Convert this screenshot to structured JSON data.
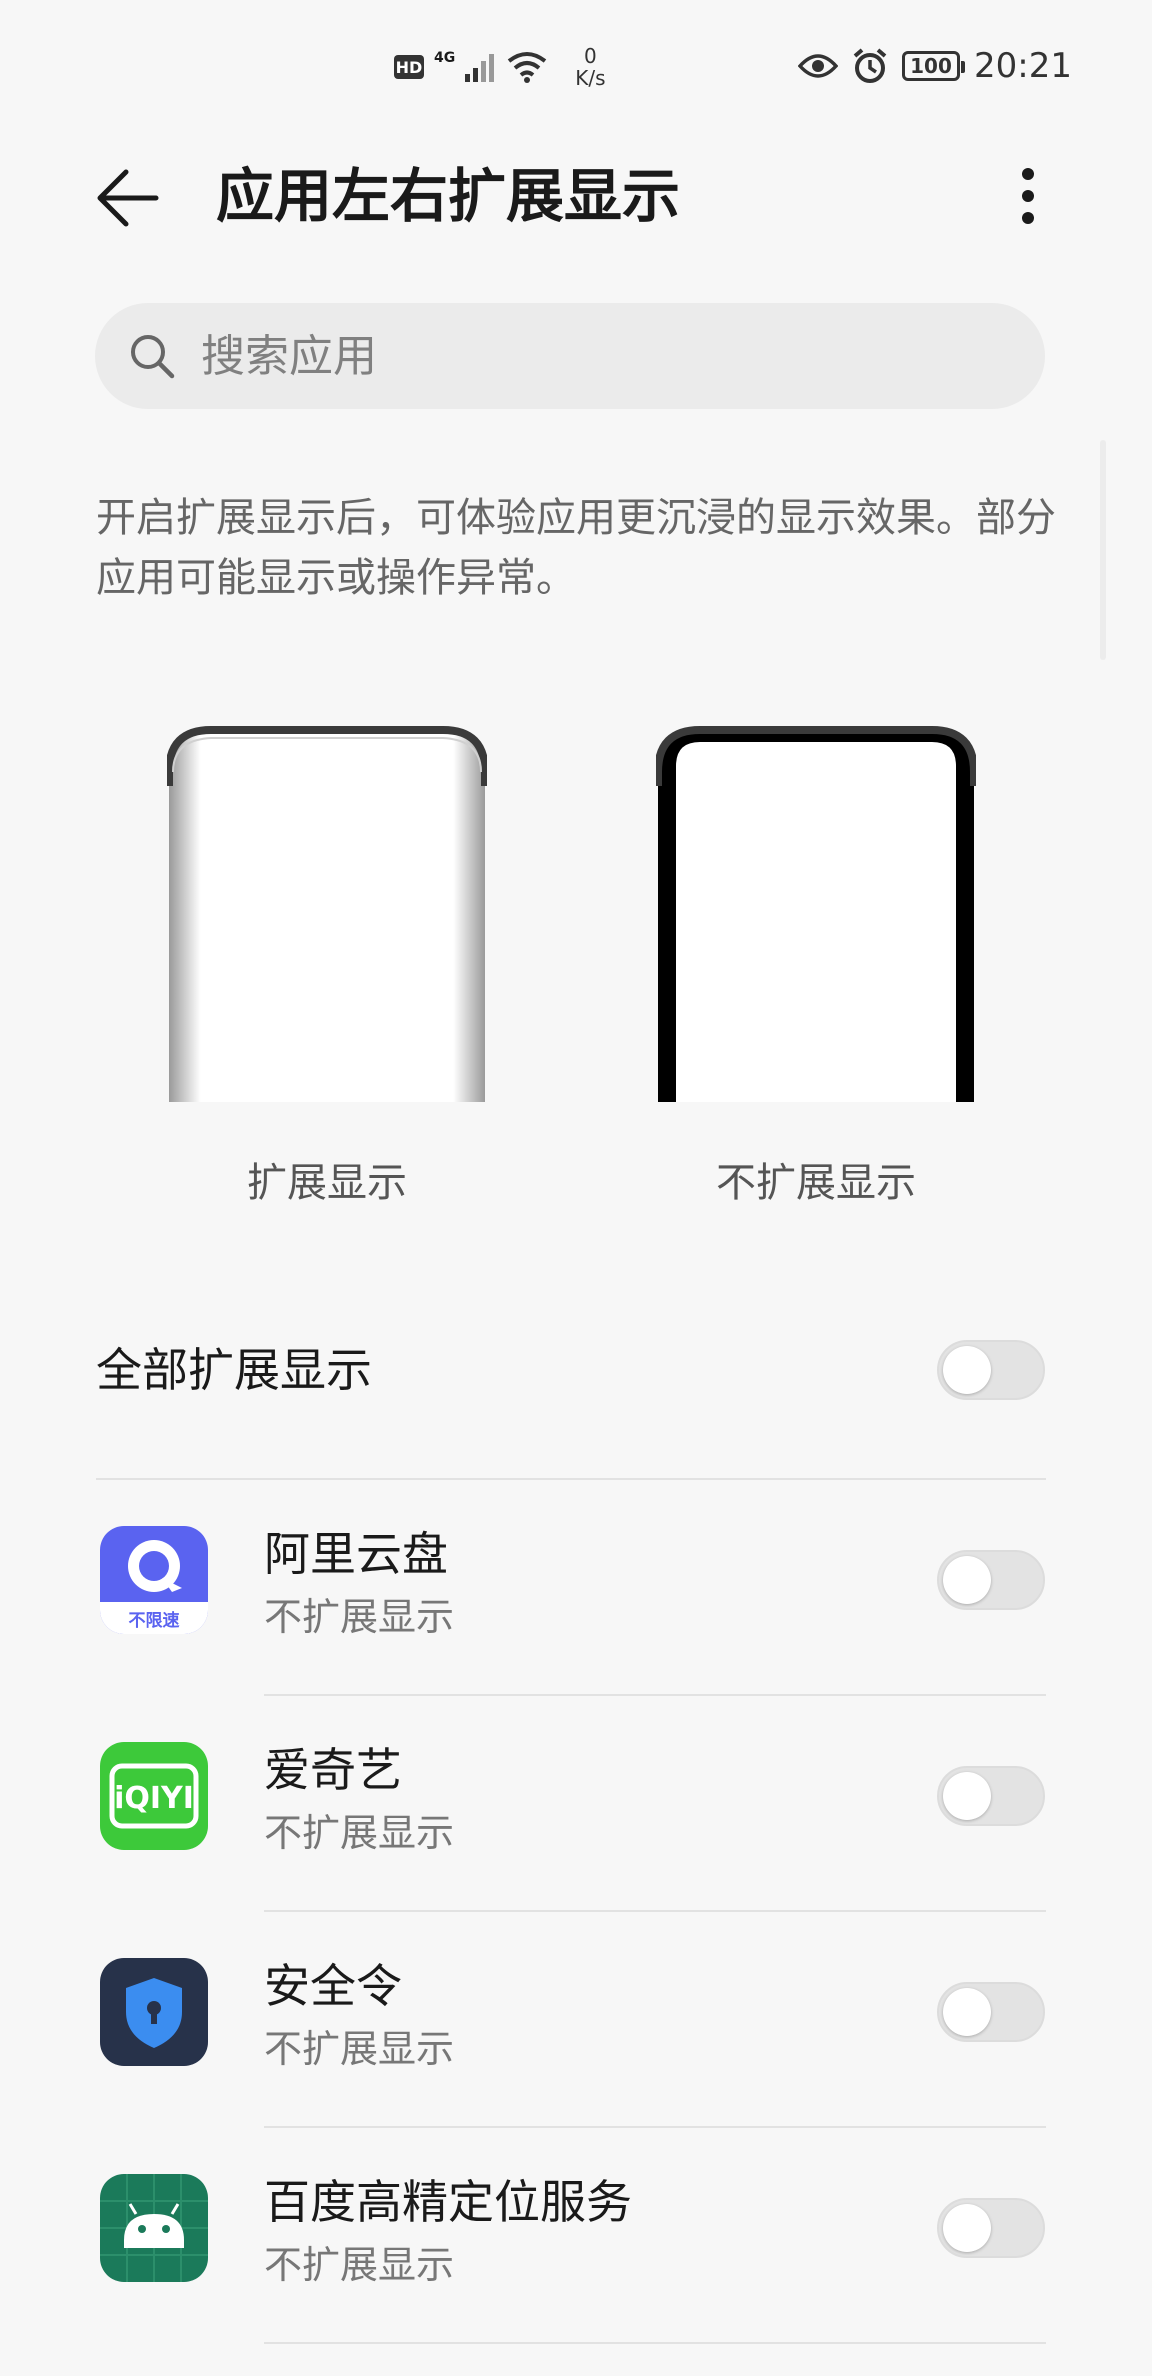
{
  "status_bar": {
    "hd": "HD",
    "network": "4G",
    "speed_value": "0",
    "speed_unit": "K/s",
    "battery": "100",
    "time": "20:21"
  },
  "header": {
    "title": "应用左右扩展显示"
  },
  "search": {
    "placeholder": "搜索应用"
  },
  "description": "开启扩展显示后，可体验应用更沉浸的显示效果。部分应用可能显示或操作异常。",
  "illustrations": {
    "expanded_label": "扩展显示",
    "normal_label": "不扩展显示"
  },
  "all_toggle": {
    "label": "全部扩展显示",
    "on": false
  },
  "apps": [
    {
      "name": "阿里云盘",
      "status": "不扩展显示",
      "icon": "aliyun-drive-icon",
      "icon_text": "不限速",
      "on": false
    },
    {
      "name": "爱奇艺",
      "status": "不扩展显示",
      "icon": "iqiyi-icon",
      "icon_text": "iQIYI",
      "on": false
    },
    {
      "name": "安全令",
      "status": "不扩展显示",
      "icon": "security-token-icon",
      "on": false
    },
    {
      "name": "百度高精定位服务",
      "status": "不扩展显示",
      "icon": "android-icon",
      "on": false
    }
  ],
  "colors": {
    "background": "#f7f7f7",
    "aliyun_blue": "#5a63f0",
    "iqiyi_green": "#3dc93a",
    "security_dark": "#27324a",
    "security_blue": "#3b8df0",
    "android_green": "#1b7a5a"
  }
}
